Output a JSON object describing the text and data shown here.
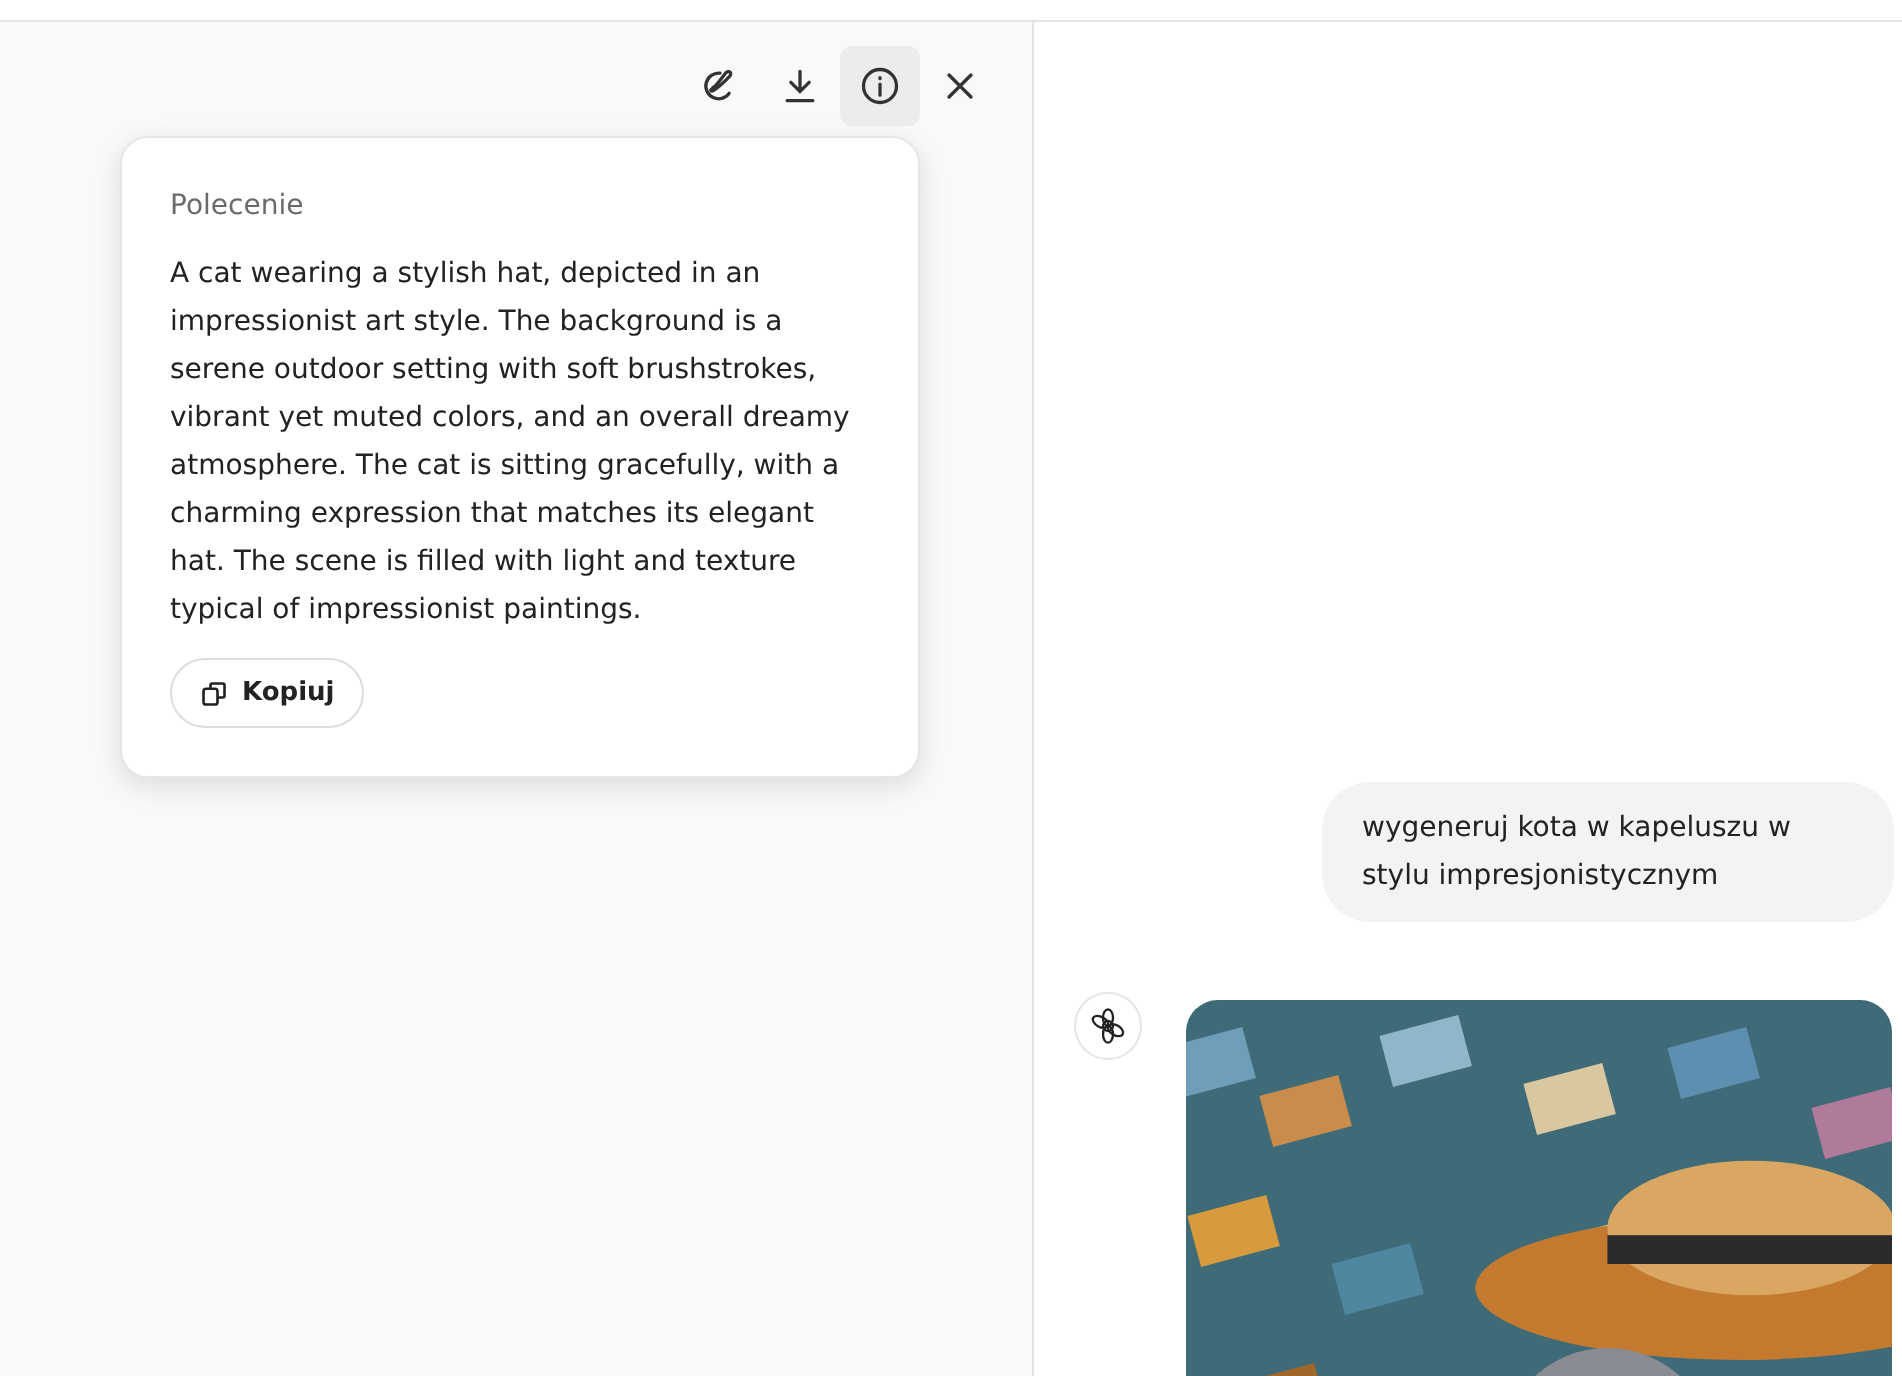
{
  "toolbar": [
    {
      "kind": "edit",
      "active": false
    },
    {
      "kind": "download",
      "active": false
    },
    {
      "kind": "info",
      "active": true
    },
    {
      "kind": "close",
      "active": false
    }
  ],
  "prompt_popover": {
    "title": "Polecenie",
    "text": "A cat wearing a stylish hat, depicted in an impressionist art style. The background is a serene outdoor setting with soft brushstrokes, vibrant yet muted colors, and an overall dreamy atmosphere. The cat is sitting gracefully, with a charming expression that matches its elegant hat. The scene is filled with light and texture typical of impressionist paintings.",
    "copy_button": "Kopiuj"
  },
  "chat": {
    "user_message": "wygeneruj kota w kapeluszu w stylu impresjonistycznym"
  }
}
